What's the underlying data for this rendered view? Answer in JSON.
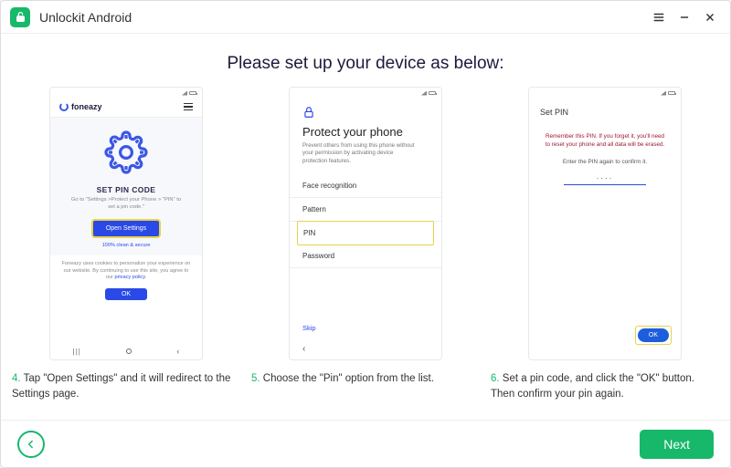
{
  "app": {
    "title": "Unlockit Android"
  },
  "heading": "Please set up your device as below:",
  "phone1": {
    "brand": "foneazy",
    "title": "SET PIN CODE",
    "subtitle": "Go to \"Settings >Protect your Phone > \"PIN\" to set a pin code.\"",
    "button": "Open Settings",
    "tagline": "100% clean & secure",
    "cookie_text": "Foneazy uses cookies to personalize your experience on our website. By continuing to use this site, you agree to our ",
    "cookie_link": "privacy policy",
    "ok": "OK"
  },
  "phone2": {
    "title": "Protect your phone",
    "desc": "Prevent others from using this phone without your permission by activating device protection features.",
    "items": [
      "Face recognition",
      "Pattern",
      "PIN",
      "Password"
    ],
    "skip": "Skip"
  },
  "phone3": {
    "header": "Set PIN",
    "warning": "Remember this PIN. If you forget it, you'll need to reset your phone and all data will be erased.",
    "instruction": "Enter the PIN again to confirm it.",
    "pin_value": "····",
    "ok": "OK"
  },
  "steps": {
    "s4_num": "4.",
    "s4": " Tap \"Open Settings\" and it will redirect to the Settings page.",
    "s5_num": "5.",
    "s5": " Choose the \"Pin\" option from the list.",
    "s6_num": "6.",
    "s6": " Set a pin code, and click the \"OK\" button. Then confirm your pin again."
  },
  "footer": {
    "next": "Next"
  }
}
